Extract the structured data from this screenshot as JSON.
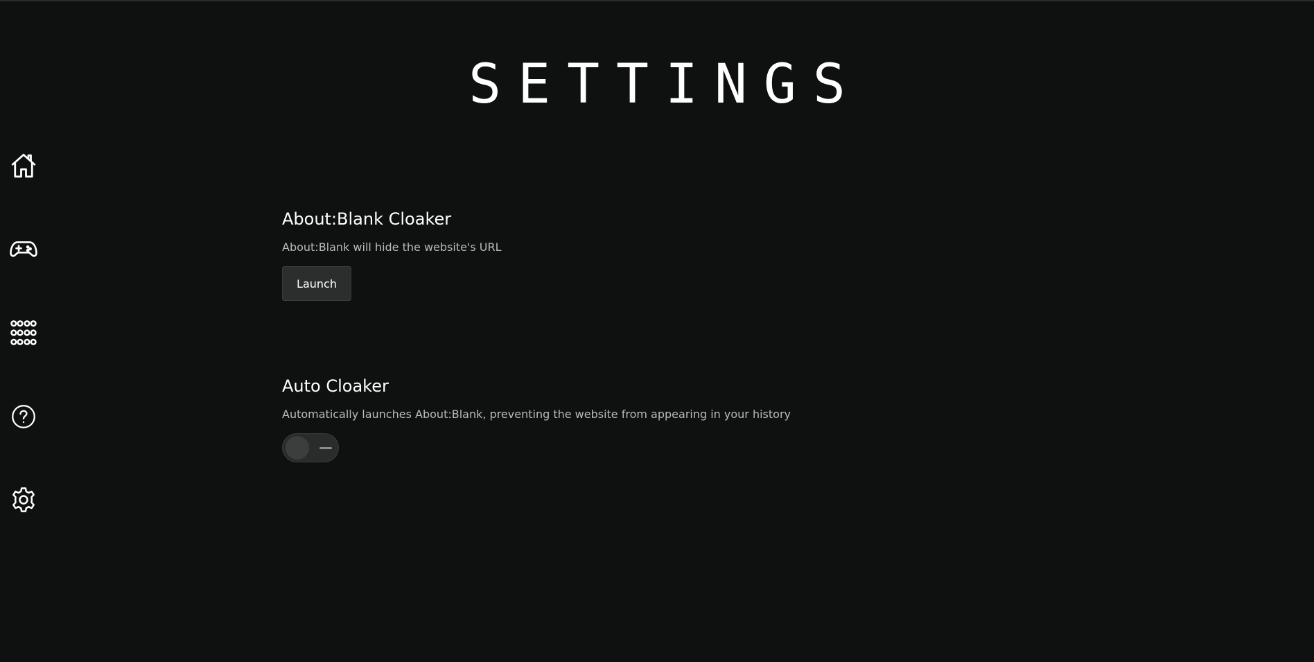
{
  "page": {
    "title": "SETTINGS"
  },
  "sidebar": {
    "items": [
      {
        "name": "home",
        "icon": "home-icon"
      },
      {
        "name": "games",
        "icon": "gamepad-icon"
      },
      {
        "name": "apps",
        "icon": "grid-dots-icon"
      },
      {
        "name": "help",
        "icon": "help-circle-icon"
      },
      {
        "name": "settings",
        "icon": "gear-icon"
      }
    ]
  },
  "sections": {
    "about_blank": {
      "heading": "About:Blank Cloaker",
      "description": "About:Blank will hide the website's URL",
      "button_label": "Launch"
    },
    "auto_cloaker": {
      "heading": "Auto Cloaker",
      "description": "Automatically launches About:Blank, preventing the website from appearing in your history",
      "toggle_state": "off"
    }
  },
  "colors": {
    "background": "#0f1110",
    "text": "#ffffff",
    "muted_text": "#b9bcbb",
    "button_bg": "#2c2d2d"
  }
}
